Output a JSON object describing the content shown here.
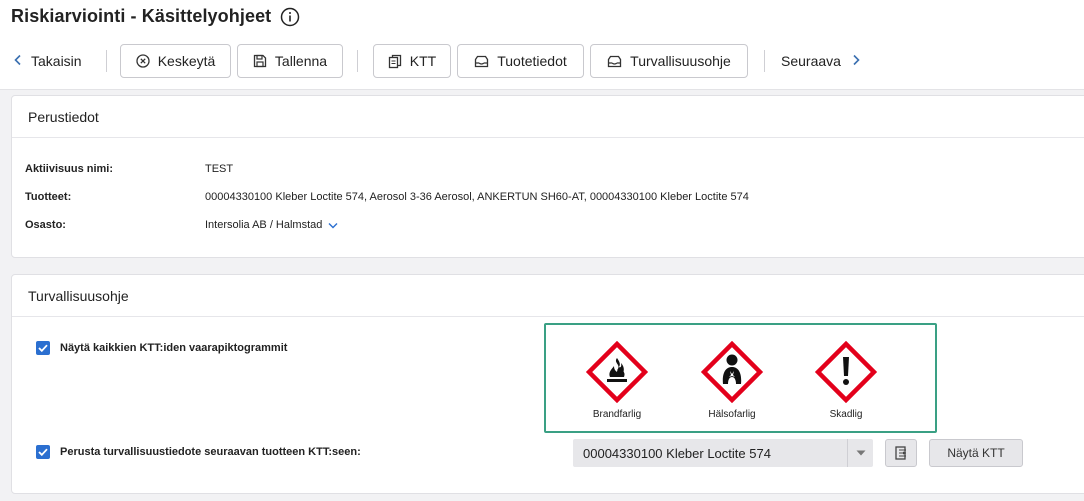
{
  "header": {
    "title": "Riskiarviointi - Käsittelyohjeet"
  },
  "toolbar": {
    "back_label": "Takaisin",
    "cancel_label": "Keskeytä",
    "save_label": "Tallenna",
    "ktt_label": "KTT",
    "product_info_label": "Tuotetiedot",
    "safety_instruction_label": "Turvallisuusohje",
    "next_label": "Seuraava"
  },
  "basic_info": {
    "title": "Perustiedot",
    "fields": [
      {
        "label": "Aktiivisuus nimi:",
        "value": "TEST"
      },
      {
        "label": "Tuotteet:",
        "value": "00004330100 Kleber Loctite 574, Aerosol 3-36 Aerosol, ANKERTUN SH60-AT, 00004330100 Kleber Loctite 574"
      },
      {
        "label": "Osasto:",
        "value": "Intersolia AB / Halmstad"
      }
    ]
  },
  "safety": {
    "title": "Turvallisuusohje",
    "show_all_pictograms_label": "Näytä kaikkien KTT:iden vaarapiktogrammit",
    "show_all_pictograms_checked": true,
    "pictograms": [
      {
        "icon": "flame-pictogram",
        "label": "Brandfarlig"
      },
      {
        "icon": "health-hazard-pictogram",
        "label": "Hälsofarlig"
      },
      {
        "icon": "exclamation-pictogram",
        "label": "Skadlig"
      }
    ],
    "base_on_product_label": "Perusta turvallisuustiedote seuraavan tuotteen KTT:seen:",
    "base_on_product_checked": true,
    "selected_product": "00004330100 Kleber Loctite 574",
    "show_ktt_label": "Näytä KTT"
  },
  "colors": {
    "accent_blue": "#2b6fd0",
    "highlight_green": "#3aa084",
    "hazard_red": "#e3001b"
  }
}
